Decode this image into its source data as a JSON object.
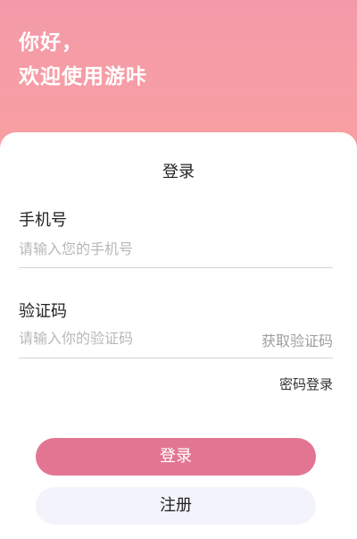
{
  "header": {
    "greeting": "你好，",
    "welcome": "欢迎使用游咔"
  },
  "form": {
    "title": "登录",
    "phone_label": "手机号",
    "phone_placeholder": "请输入您的手机号",
    "phone_value": "",
    "code_label": "验证码",
    "code_placeholder": "请输入你的验证码",
    "code_value": "",
    "get_code_label": "获取验证码",
    "password_login_label": "密码登录"
  },
  "actions": {
    "login_label": "登录",
    "register_label": "注册"
  },
  "colors": {
    "header_gradient_top": "#f39aa9",
    "header_gradient_bottom": "#f9a0a3",
    "login_button": "#e27692",
    "register_button": "#f3f4fb"
  }
}
